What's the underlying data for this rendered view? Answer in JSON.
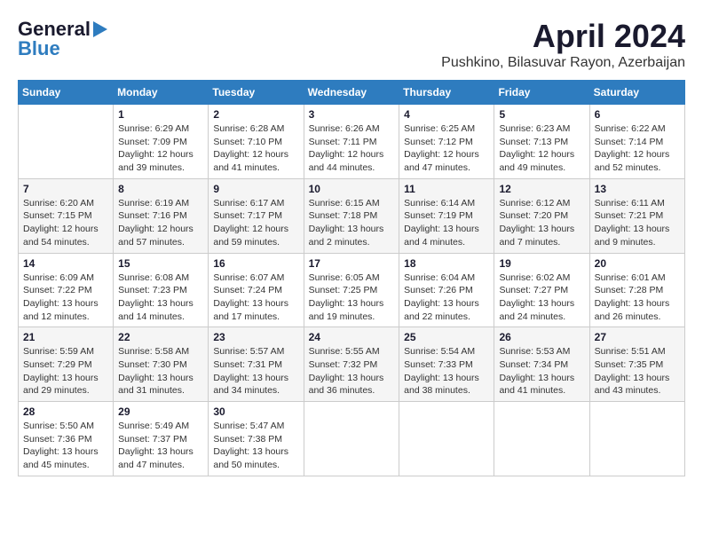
{
  "header": {
    "logo_general": "General",
    "logo_blue": "Blue",
    "month_title": "April 2024",
    "location": "Pushkino, Bilasuvar Rayon, Azerbaijan"
  },
  "weekdays": [
    "Sunday",
    "Monday",
    "Tuesday",
    "Wednesday",
    "Thursday",
    "Friday",
    "Saturday"
  ],
  "weeks": [
    [
      {
        "day": "",
        "sunrise": "",
        "sunset": "",
        "daylight": ""
      },
      {
        "day": "1",
        "sunrise": "Sunrise: 6:29 AM",
        "sunset": "Sunset: 7:09 PM",
        "daylight": "Daylight: 12 hours and 39 minutes."
      },
      {
        "day": "2",
        "sunrise": "Sunrise: 6:28 AM",
        "sunset": "Sunset: 7:10 PM",
        "daylight": "Daylight: 12 hours and 41 minutes."
      },
      {
        "day": "3",
        "sunrise": "Sunrise: 6:26 AM",
        "sunset": "Sunset: 7:11 PM",
        "daylight": "Daylight: 12 hours and 44 minutes."
      },
      {
        "day": "4",
        "sunrise": "Sunrise: 6:25 AM",
        "sunset": "Sunset: 7:12 PM",
        "daylight": "Daylight: 12 hours and 47 minutes."
      },
      {
        "day": "5",
        "sunrise": "Sunrise: 6:23 AM",
        "sunset": "Sunset: 7:13 PM",
        "daylight": "Daylight: 12 hours and 49 minutes."
      },
      {
        "day": "6",
        "sunrise": "Sunrise: 6:22 AM",
        "sunset": "Sunset: 7:14 PM",
        "daylight": "Daylight: 12 hours and 52 minutes."
      }
    ],
    [
      {
        "day": "7",
        "sunrise": "Sunrise: 6:20 AM",
        "sunset": "Sunset: 7:15 PM",
        "daylight": "Daylight: 12 hours and 54 minutes."
      },
      {
        "day": "8",
        "sunrise": "Sunrise: 6:19 AM",
        "sunset": "Sunset: 7:16 PM",
        "daylight": "Daylight: 12 hours and 57 minutes."
      },
      {
        "day": "9",
        "sunrise": "Sunrise: 6:17 AM",
        "sunset": "Sunset: 7:17 PM",
        "daylight": "Daylight: 12 hours and 59 minutes."
      },
      {
        "day": "10",
        "sunrise": "Sunrise: 6:15 AM",
        "sunset": "Sunset: 7:18 PM",
        "daylight": "Daylight: 13 hours and 2 minutes."
      },
      {
        "day": "11",
        "sunrise": "Sunrise: 6:14 AM",
        "sunset": "Sunset: 7:19 PM",
        "daylight": "Daylight: 13 hours and 4 minutes."
      },
      {
        "day": "12",
        "sunrise": "Sunrise: 6:12 AM",
        "sunset": "Sunset: 7:20 PM",
        "daylight": "Daylight: 13 hours and 7 minutes."
      },
      {
        "day": "13",
        "sunrise": "Sunrise: 6:11 AM",
        "sunset": "Sunset: 7:21 PM",
        "daylight": "Daylight: 13 hours and 9 minutes."
      }
    ],
    [
      {
        "day": "14",
        "sunrise": "Sunrise: 6:09 AM",
        "sunset": "Sunset: 7:22 PM",
        "daylight": "Daylight: 13 hours and 12 minutes."
      },
      {
        "day": "15",
        "sunrise": "Sunrise: 6:08 AM",
        "sunset": "Sunset: 7:23 PM",
        "daylight": "Daylight: 13 hours and 14 minutes."
      },
      {
        "day": "16",
        "sunrise": "Sunrise: 6:07 AM",
        "sunset": "Sunset: 7:24 PM",
        "daylight": "Daylight: 13 hours and 17 minutes."
      },
      {
        "day": "17",
        "sunrise": "Sunrise: 6:05 AM",
        "sunset": "Sunset: 7:25 PM",
        "daylight": "Daylight: 13 hours and 19 minutes."
      },
      {
        "day": "18",
        "sunrise": "Sunrise: 6:04 AM",
        "sunset": "Sunset: 7:26 PM",
        "daylight": "Daylight: 13 hours and 22 minutes."
      },
      {
        "day": "19",
        "sunrise": "Sunrise: 6:02 AM",
        "sunset": "Sunset: 7:27 PM",
        "daylight": "Daylight: 13 hours and 24 minutes."
      },
      {
        "day": "20",
        "sunrise": "Sunrise: 6:01 AM",
        "sunset": "Sunset: 7:28 PM",
        "daylight": "Daylight: 13 hours and 26 minutes."
      }
    ],
    [
      {
        "day": "21",
        "sunrise": "Sunrise: 5:59 AM",
        "sunset": "Sunset: 7:29 PM",
        "daylight": "Daylight: 13 hours and 29 minutes."
      },
      {
        "day": "22",
        "sunrise": "Sunrise: 5:58 AM",
        "sunset": "Sunset: 7:30 PM",
        "daylight": "Daylight: 13 hours and 31 minutes."
      },
      {
        "day": "23",
        "sunrise": "Sunrise: 5:57 AM",
        "sunset": "Sunset: 7:31 PM",
        "daylight": "Daylight: 13 hours and 34 minutes."
      },
      {
        "day": "24",
        "sunrise": "Sunrise: 5:55 AM",
        "sunset": "Sunset: 7:32 PM",
        "daylight": "Daylight: 13 hours and 36 minutes."
      },
      {
        "day": "25",
        "sunrise": "Sunrise: 5:54 AM",
        "sunset": "Sunset: 7:33 PM",
        "daylight": "Daylight: 13 hours and 38 minutes."
      },
      {
        "day": "26",
        "sunrise": "Sunrise: 5:53 AM",
        "sunset": "Sunset: 7:34 PM",
        "daylight": "Daylight: 13 hours and 41 minutes."
      },
      {
        "day": "27",
        "sunrise": "Sunrise: 5:51 AM",
        "sunset": "Sunset: 7:35 PM",
        "daylight": "Daylight: 13 hours and 43 minutes."
      }
    ],
    [
      {
        "day": "28",
        "sunrise": "Sunrise: 5:50 AM",
        "sunset": "Sunset: 7:36 PM",
        "daylight": "Daylight: 13 hours and 45 minutes."
      },
      {
        "day": "29",
        "sunrise": "Sunrise: 5:49 AM",
        "sunset": "Sunset: 7:37 PM",
        "daylight": "Daylight: 13 hours and 47 minutes."
      },
      {
        "day": "30",
        "sunrise": "Sunrise: 5:47 AM",
        "sunset": "Sunset: 7:38 PM",
        "daylight": "Daylight: 13 hours and 50 minutes."
      },
      {
        "day": "",
        "sunrise": "",
        "sunset": "",
        "daylight": ""
      },
      {
        "day": "",
        "sunrise": "",
        "sunset": "",
        "daylight": ""
      },
      {
        "day": "",
        "sunrise": "",
        "sunset": "",
        "daylight": ""
      },
      {
        "day": "",
        "sunrise": "",
        "sunset": "",
        "daylight": ""
      }
    ]
  ]
}
